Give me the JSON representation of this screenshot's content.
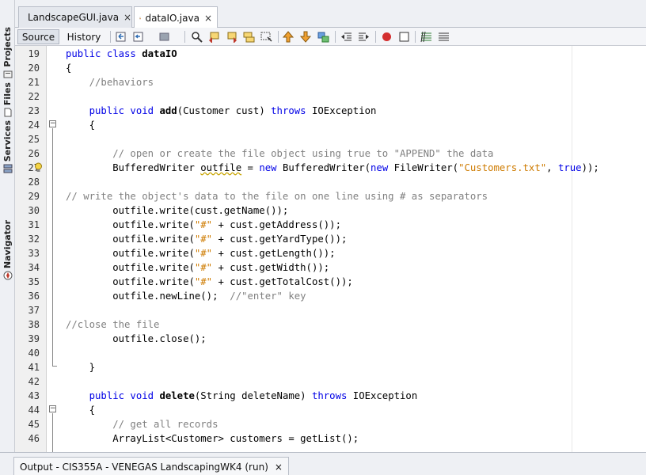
{
  "sidebar": {
    "tabs": [
      {
        "label": "Projects",
        "icon": "projects-icon"
      },
      {
        "label": "Files",
        "icon": "files-icon"
      },
      {
        "label": "Services",
        "icon": "services-icon"
      },
      {
        "label": "Navigator",
        "icon": "navigator-icon"
      }
    ]
  },
  "editor_tabs": [
    {
      "label": "LandscapeGUI.java",
      "icon": "java-file-icon",
      "close": "×",
      "active": false
    },
    {
      "label": "dataIO.java",
      "icon": "java-file-icon",
      "close": "×",
      "active": true
    }
  ],
  "toolbar": {
    "source_label": "Source",
    "history_label": "History",
    "icons": [
      "last-edit-icon",
      "back-icon",
      "forward-icon",
      "find-icon",
      "find-previous-icon",
      "find-next-icon",
      "find-selection-icon",
      "toggle-highlight-icon",
      "prev-bookmark-icon",
      "next-bookmark-icon",
      "toggle-bookmark-icon",
      "shift-left-icon",
      "shift-right-icon",
      "record-macro-icon",
      "stop-macro-icon",
      "comment-icon",
      "uncomment-icon"
    ]
  },
  "code": {
    "lines": [
      {
        "n": "19",
        "tokens": [
          {
            "t": "public class ",
            "c": "kw"
          },
          {
            "t": "dataIO",
            "c": "fn"
          }
        ]
      },
      {
        "n": "20",
        "tokens": [
          {
            "t": "{",
            "c": ""
          }
        ]
      },
      {
        "n": "21",
        "tokens": [
          {
            "t": "    //behaviors",
            "c": "cm"
          }
        ]
      },
      {
        "n": "22",
        "tokens": []
      },
      {
        "n": "23",
        "tokens": [
          {
            "t": "    public void ",
            "c": "kw"
          },
          {
            "t": "add",
            "c": "fn"
          },
          {
            "t": "(Customer cust) ",
            "c": ""
          },
          {
            "t": "throws",
            "c": "kw"
          },
          {
            "t": " IOException",
            "c": ""
          }
        ]
      },
      {
        "n": "24",
        "tokens": [
          {
            "t": "    {",
            "c": ""
          }
        ]
      },
      {
        "n": "25",
        "tokens": []
      },
      {
        "n": "26",
        "tokens": [
          {
            "t": "        // open or create the file object using true to \"APPEND\" the data",
            "c": "cm"
          }
        ]
      },
      {
        "n": "27",
        "tokens": [
          {
            "t": "        BufferedWriter ",
            "c": ""
          },
          {
            "t": "outfile",
            "c": "squig"
          },
          {
            "t": " = ",
            "c": ""
          },
          {
            "t": "new",
            "c": "kw"
          },
          {
            "t": " BufferedWriter(",
            "c": ""
          },
          {
            "t": "new",
            "c": "kw"
          },
          {
            "t": " FileWriter(",
            "c": ""
          },
          {
            "t": "\"Customers.txt\"",
            "c": "st"
          },
          {
            "t": ", ",
            "c": ""
          },
          {
            "t": "true",
            "c": "kw"
          },
          {
            "t": "));",
            "c": ""
          }
        ]
      },
      {
        "n": "28",
        "tokens": []
      },
      {
        "n": "29",
        "tokens": [
          {
            "t": "// write the object's data to the file on one line using # as separators",
            "c": "cm"
          }
        ]
      },
      {
        "n": "30",
        "tokens": [
          {
            "t": "        outfile.write(cust.getName());",
            "c": ""
          }
        ]
      },
      {
        "n": "31",
        "tokens": [
          {
            "t": "        outfile.write(",
            "c": ""
          },
          {
            "t": "\"#\"",
            "c": "st"
          },
          {
            "t": " + cust.getAddress());",
            "c": ""
          }
        ]
      },
      {
        "n": "32",
        "tokens": [
          {
            "t": "        outfile.write(",
            "c": ""
          },
          {
            "t": "\"#\"",
            "c": "st"
          },
          {
            "t": " + cust.getYardType());",
            "c": ""
          }
        ]
      },
      {
        "n": "33",
        "tokens": [
          {
            "t": "        outfile.write(",
            "c": ""
          },
          {
            "t": "\"#\"",
            "c": "st"
          },
          {
            "t": " + cust.getLength());",
            "c": ""
          }
        ]
      },
      {
        "n": "34",
        "tokens": [
          {
            "t": "        outfile.write(",
            "c": ""
          },
          {
            "t": "\"#\"",
            "c": "st"
          },
          {
            "t": " + cust.getWidth());",
            "c": ""
          }
        ]
      },
      {
        "n": "35",
        "tokens": [
          {
            "t": "        outfile.write(",
            "c": ""
          },
          {
            "t": "\"#\"",
            "c": "st"
          },
          {
            "t": " + cust.getTotalCost());",
            "c": ""
          }
        ]
      },
      {
        "n": "36",
        "tokens": [
          {
            "t": "        outfile.newLine();  ",
            "c": ""
          },
          {
            "t": "//\"enter\" key",
            "c": "cm"
          }
        ]
      },
      {
        "n": "37",
        "tokens": []
      },
      {
        "n": "38",
        "tokens": [
          {
            "t": "//close the file",
            "c": "cm"
          }
        ]
      },
      {
        "n": "39",
        "tokens": [
          {
            "t": "        outfile.close();",
            "c": ""
          }
        ]
      },
      {
        "n": "40",
        "tokens": []
      },
      {
        "n": "41",
        "tokens": [
          {
            "t": "    }",
            "c": ""
          }
        ]
      },
      {
        "n": "42",
        "tokens": []
      },
      {
        "n": "43",
        "tokens": [
          {
            "t": "    public void ",
            "c": "kw"
          },
          {
            "t": "delete",
            "c": "fn"
          },
          {
            "t": "(String deleteName) ",
            "c": ""
          },
          {
            "t": "throws",
            "c": "kw"
          },
          {
            "t": " IOException",
            "c": ""
          }
        ]
      },
      {
        "n": "44",
        "tokens": [
          {
            "t": "    {",
            "c": ""
          }
        ]
      },
      {
        "n": "45",
        "tokens": [
          {
            "t": "        // get all records",
            "c": "cm"
          }
        ]
      },
      {
        "n": "46",
        "tokens": [
          {
            "t": "        ArrayList<Customer> customers = getList();",
            "c": ""
          }
        ]
      }
    ]
  },
  "output": {
    "tab_label": "Output - CIS355A - VENEGAS LandscapingWK4 (run)",
    "close": "×"
  },
  "colors": {
    "keyword": "#0000e6",
    "comment": "#808080",
    "string": "#ce7b00",
    "panel": "#eef0f4"
  }
}
